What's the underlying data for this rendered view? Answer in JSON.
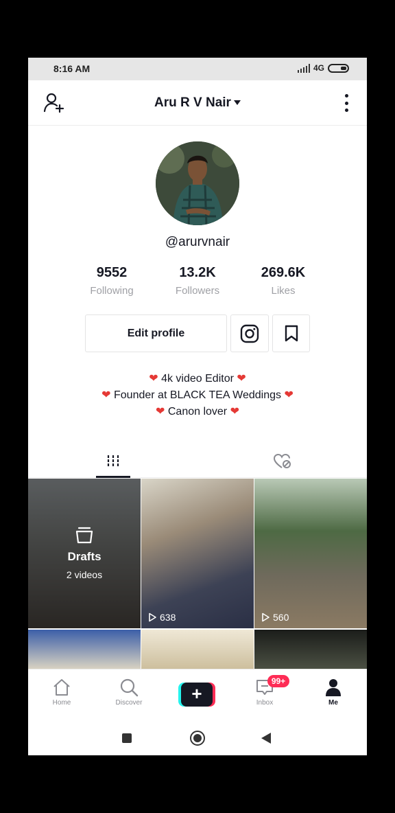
{
  "status_bar": {
    "time": "8:16 AM",
    "network": "4G"
  },
  "header": {
    "title": "Aru R V Nair"
  },
  "profile": {
    "username": "@arurvnair",
    "stats": [
      {
        "value": "9552",
        "label": "Following"
      },
      {
        "value": "13.2K",
        "label": "Followers"
      },
      {
        "value": "269.6K",
        "label": "Likes"
      }
    ],
    "edit_profile_label": "Edit profile",
    "bio": [
      "4k video Editor",
      "Founder at BLACK TEA Weddings",
      "Canon lover"
    ]
  },
  "tabs": {
    "active": "videos",
    "underline_color": "#161823"
  },
  "grid": {
    "drafts_title": "Drafts",
    "drafts_count": "2 videos",
    "video_views": [
      "638",
      "560"
    ]
  },
  "bottom_nav": {
    "home": "Home",
    "discover": "Discover",
    "inbox": "Inbox",
    "inbox_badge": "99+",
    "me": "Me"
  },
  "colors": {
    "accent_red": "#fe2c55",
    "accent_cyan": "#25f4ee",
    "heart": "#e53935"
  }
}
